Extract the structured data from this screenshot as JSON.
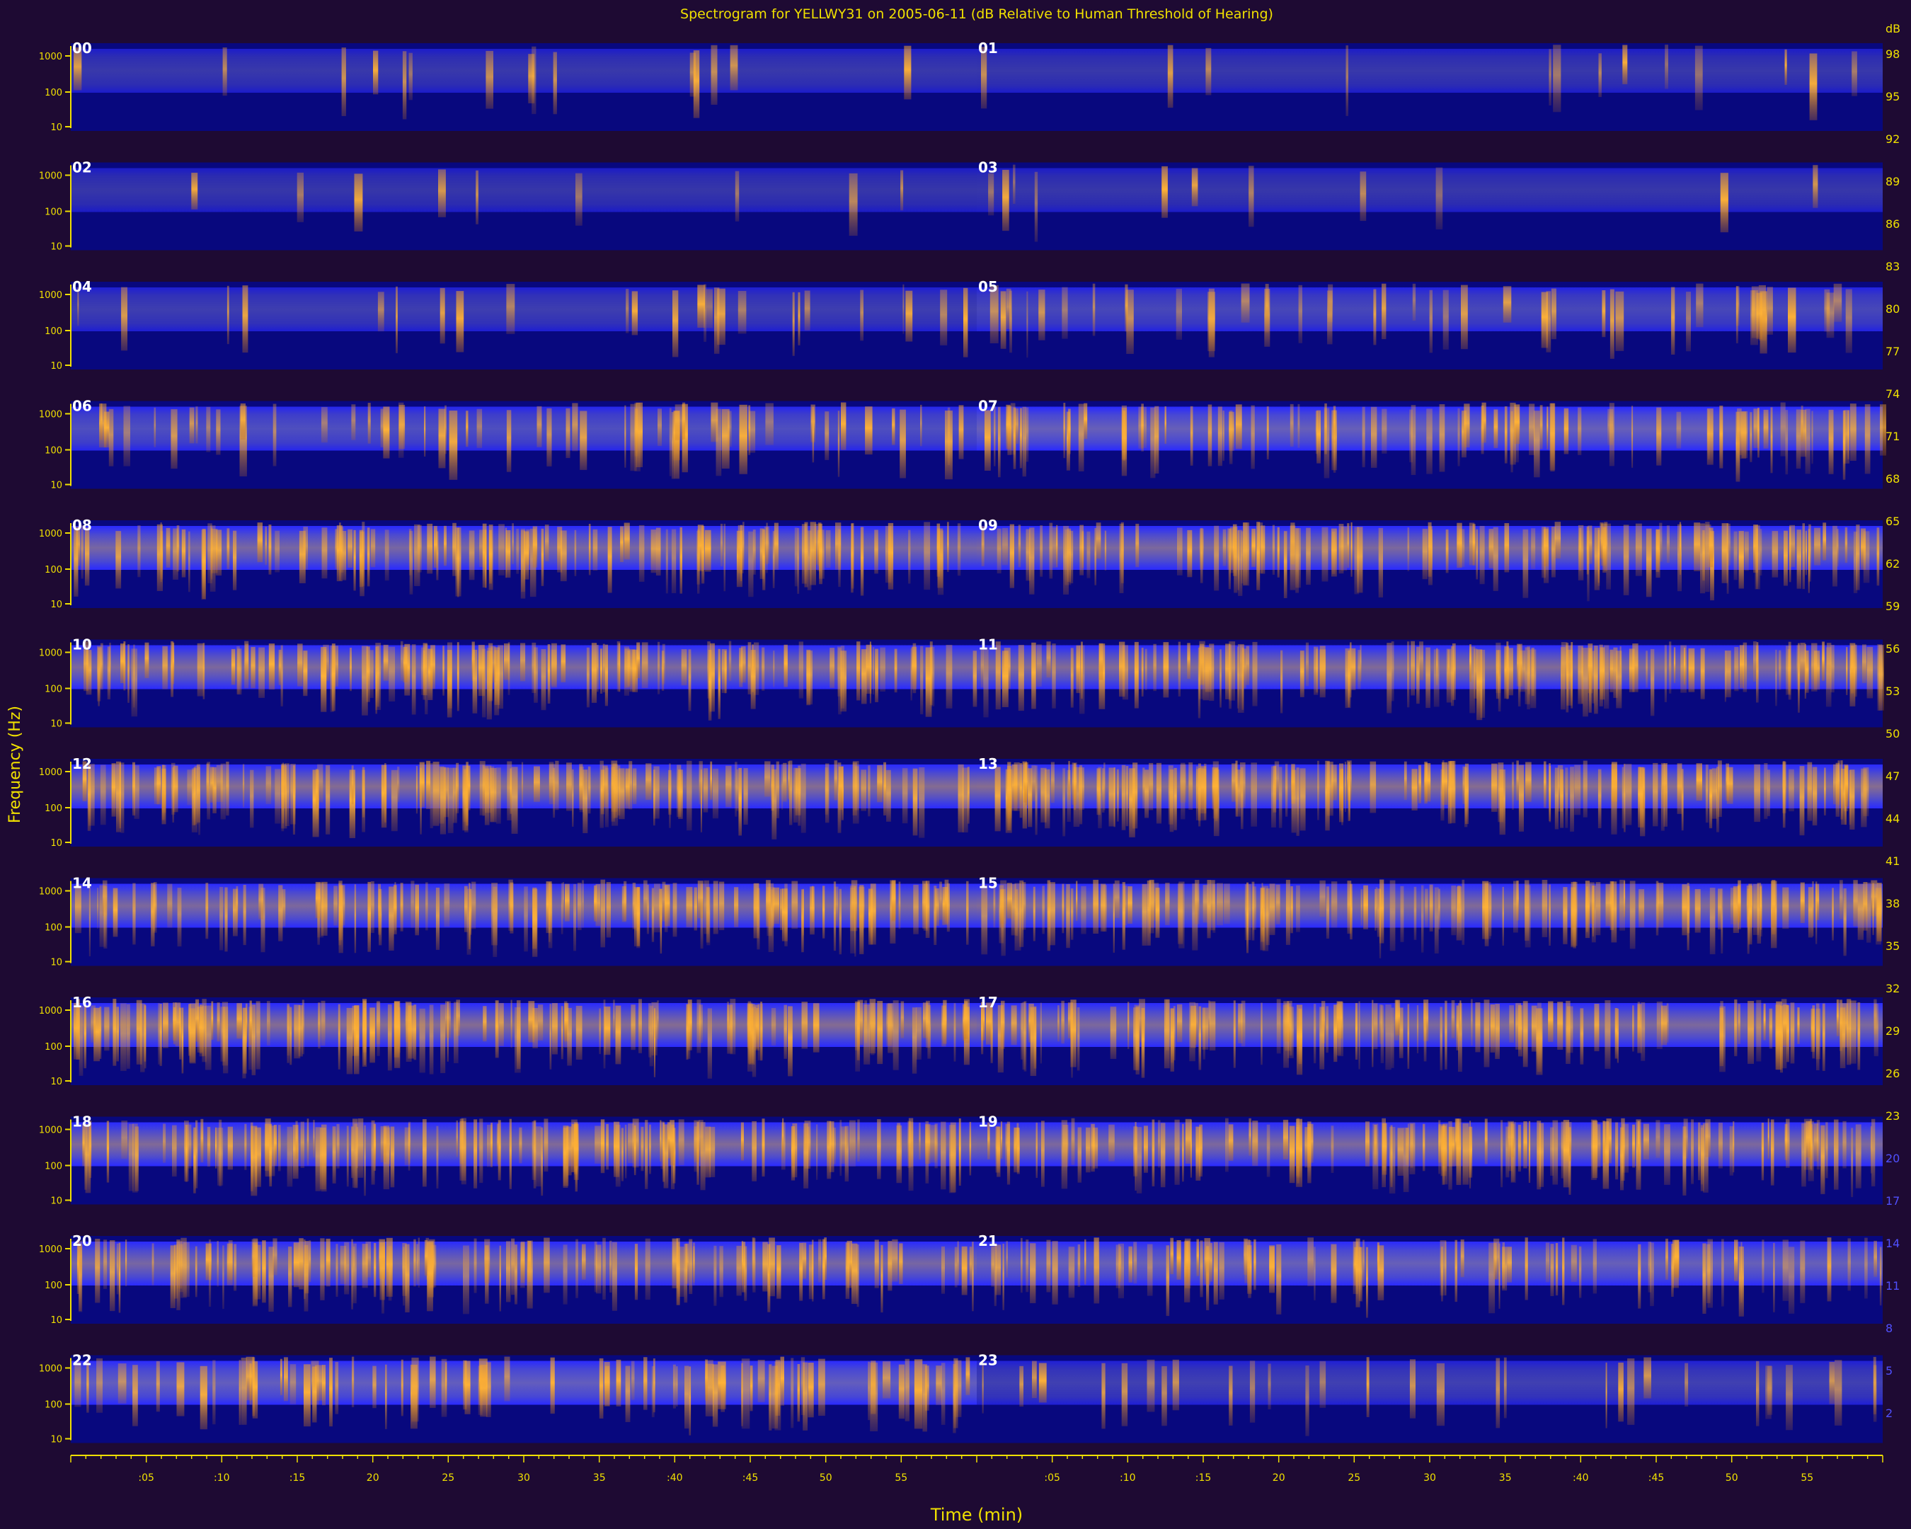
{
  "chart_data": {
    "type": "heatmap",
    "title": "Spectrogram for YELLWY31 on 2005-06-11 (dB Relative to Human Threshold of Hearing)",
    "xlabel": "Time (min)",
    "ylabel": "Frequency (Hz)",
    "x_tick_labels_left": [
      ":05",
      ":10",
      ":15",
      "20",
      "25",
      "30",
      "35",
      ":40",
      ":45",
      "50",
      "55"
    ],
    "x_tick_labels_right": [
      ":05",
      ":10",
      ":15",
      "20",
      "25",
      "30",
      "35",
      ":40",
      ":45",
      "50",
      "55"
    ],
    "freq_tick_labels": [
      "1000",
      "100",
      "10"
    ],
    "colorbar_labels": [
      "dB",
      "98",
      "95",
      "92",
      "89",
      "86",
      "83",
      "80",
      "77",
      "74",
      "71",
      "68",
      "65",
      "62",
      "59",
      "56",
      "53",
      "50",
      "47",
      "44",
      "41",
      "38",
      "35",
      "32",
      "29",
      "26",
      "23",
      "20",
      "17",
      "14",
      "11",
      "8",
      "5",
      "2"
    ],
    "colorbar_range_db": [
      2,
      98
    ],
    "hour_labels": [
      "00",
      "01",
      "02",
      "03",
      "04",
      "05",
      "06",
      "07",
      "08",
      "09",
      "10",
      "11",
      "12",
      "13",
      "14",
      "15",
      "16",
      "17",
      "18",
      "19",
      "20",
      "21",
      "22",
      "23"
    ],
    "hour_activity": [
      {
        "hour": "00",
        "activity": 0.05
      },
      {
        "hour": "01",
        "activity": 0.04
      },
      {
        "hour": "02",
        "activity": 0.02
      },
      {
        "hour": "03",
        "activity": 0.03
      },
      {
        "hour": "04",
        "activity": 0.12
      },
      {
        "hour": "05",
        "activity": 0.25
      },
      {
        "hour": "06",
        "activity": 0.35
      },
      {
        "hour": "07",
        "activity": 0.55
      },
      {
        "hour": "08",
        "activity": 0.75
      },
      {
        "hour": "09",
        "activity": 0.8
      },
      {
        "hour": "10",
        "activity": 0.8
      },
      {
        "hour": "11",
        "activity": 0.85
      },
      {
        "hour": "12",
        "activity": 0.9
      },
      {
        "hour": "13",
        "activity": 0.92
      },
      {
        "hour": "14",
        "activity": 0.8
      },
      {
        "hour": "15",
        "activity": 0.85
      },
      {
        "hour": "16",
        "activity": 0.9
      },
      {
        "hour": "17",
        "activity": 0.8
      },
      {
        "hour": "18",
        "activity": 0.85
      },
      {
        "hour": "19",
        "activity": 0.8
      },
      {
        "hour": "20",
        "activity": 0.75
      },
      {
        "hour": "21",
        "activity": 0.55
      },
      {
        "hour": "22",
        "activity": 0.5
      },
      {
        "hour": "23",
        "activity": 0.15
      }
    ],
    "colors": {
      "background": "#1e0a33",
      "plot_base": "#08087e",
      "band": "#3a3ad8",
      "band_edge": "#2222ff",
      "hot": "#f0a030",
      "axis": "#f0e000",
      "text": "#f0e000",
      "colorbar_text_high": "#f0e000",
      "colorbar_text_low": "#5050ff"
    }
  }
}
